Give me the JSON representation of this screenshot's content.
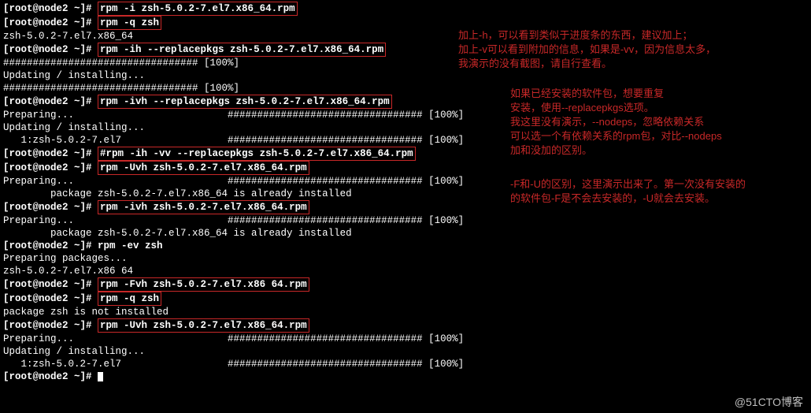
{
  "prompt": "[root@node2 ~]# ",
  "commands": {
    "c1": "rpm -i zsh-5.0.2-7.el7.x86_64.rpm",
    "c2": "rpm -q zsh",
    "c3": "rpm -ih --replacepkgs zsh-5.0.2-7.el7.x86_64.rpm",
    "c4": "rpm -ivh --replacepkgs zsh-5.0.2-7.el7.x86_64.rpm",
    "c5": "#rpm -ih -vv --replacepkgs zsh-5.0.2-7.el7.x86_64.rpm",
    "c6": "rpm -Uvh zsh-5.0.2-7.el7.x86_64.rpm",
    "c7": "rpm -ivh zsh-5.0.2-7.el7.x86_64.rpm",
    "c8": "rpm -ev zsh",
    "c9": "rpm -Fvh zsh-5.0.2-7.el7.x86 64.rpm",
    "c10": "rpm -q zsh",
    "c11": "rpm -Uvh zsh-5.0.2-7.el7.x86_64.rpm"
  },
  "outputs": {
    "ver1": "zsh-5.0.2-7.el7.x86_64",
    "hashline": "################################# [100%]",
    "updating": "Updating / installing...",
    "preparing": "Preparing...                          ################################# [100%]",
    "pkgline": "   1:zsh-5.0.2-7.el7                  ################################# [100%]",
    "already": "        package zsh-5.0.2-7.el7.x86_64 is already installed",
    "preppkgs": "Preparing packages...",
    "vernosuf": "zsh-5.0.2-7.el7.x86 64",
    "notinst": "package zsh is not installed"
  },
  "anno": {
    "a1l1": "加上-h，可以看到类似于进度条的东西，建议加上；",
    "a1l2": "加上-v可以看到附加的信息，如果是-vv，因为信息太多，",
    "a1l3": "我演示的没有截图，请自行查看。",
    "a2l1": "如果已经安装的软件包，想要重复",
    "a2l2": "安装，使用--replacepkgs选项。",
    "a2l3": "我这里没有演示，--nodeps，忽略依赖关系",
    "a2l4": "可以选一个有依赖关系的rpm包，对比--nodeps",
    "a2l5": "加和没加的区别。",
    "a3l1": "-F和-U的区别，这里演示出来了。第一次没有安装的",
    "a3l2": "的软件包-F是不会去安装的，-U就会去安装。"
  },
  "watermark": "@51CTO博客"
}
